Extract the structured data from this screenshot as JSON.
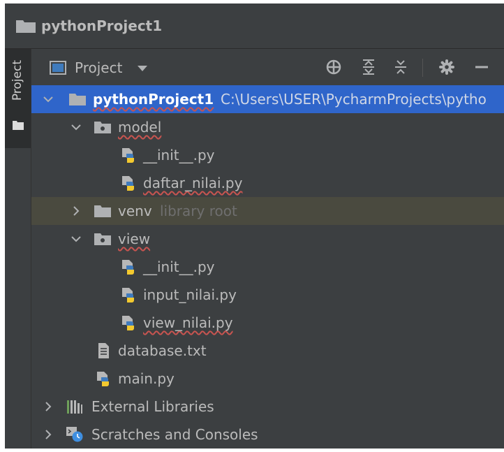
{
  "window": {
    "title": "pythonProject1"
  },
  "stripe": {
    "tab_label": "Project"
  },
  "header": {
    "view_label": "Project",
    "actions": [
      "locate-icon",
      "expand-all-icon",
      "collapse-all-icon",
      "gear-icon",
      "minimize-icon"
    ]
  },
  "tree": {
    "rows": [
      {
        "label": "pythonProject1",
        "hint": "C:\\Users\\USER\\PycharmProjects\\pytho",
        "icon": "folder-icon",
        "expanded": true
      },
      {
        "label": "model",
        "icon": "package-icon",
        "expanded": true
      },
      {
        "label": "__init__.py",
        "icon": "python-file-icon"
      },
      {
        "label": "daftar_nilai.py",
        "icon": "python-file-icon"
      },
      {
        "label": "venv",
        "hint": "library root",
        "icon": "folder-icon",
        "expanded": false
      },
      {
        "label": "view",
        "icon": "package-icon",
        "expanded": true
      },
      {
        "label": "__init__.py",
        "icon": "python-file-icon"
      },
      {
        "label": "input_nilai.py",
        "icon": "python-file-icon"
      },
      {
        "label": "view_nilai.py",
        "icon": "python-file-icon"
      },
      {
        "label": "database.txt",
        "icon": "text-file-icon"
      },
      {
        "label": "main.py",
        "icon": "python-file-icon"
      },
      {
        "label": "External Libraries",
        "icon": "libraries-icon",
        "expanded": false
      },
      {
        "label": "Scratches and Consoles",
        "icon": "scratches-icon",
        "expanded": false
      }
    ]
  },
  "colors": {
    "background": "#3c3f41",
    "selection": "#2f65ca",
    "excluded_row": "#4a4a3f",
    "text": "#bbbbbb",
    "python_blue": "#3f7bbd",
    "python_yellow": "#f3c92f"
  }
}
